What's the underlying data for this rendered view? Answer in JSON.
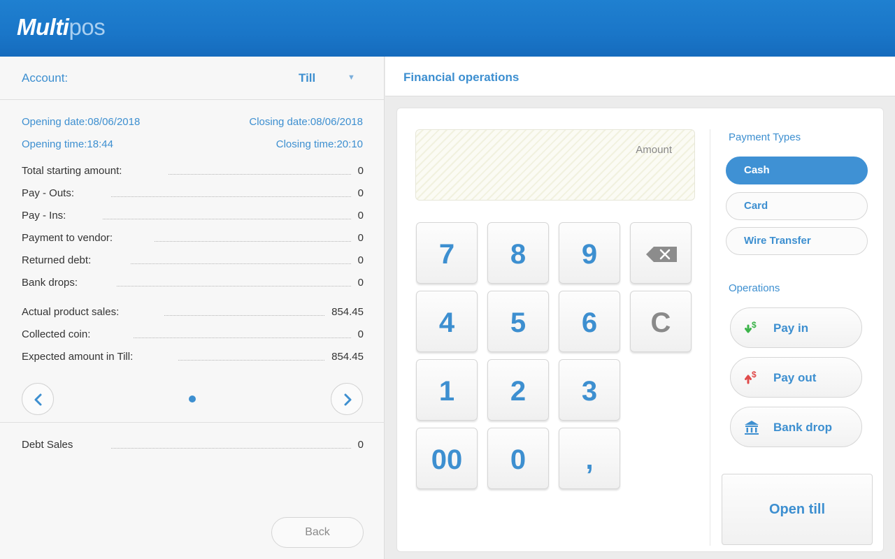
{
  "header": {
    "logo_bold": "Multi",
    "logo_light": "pos"
  },
  "left": {
    "account_label": "Account:",
    "account_value": "Till",
    "opening_date": "Opening date:08/06/2018",
    "closing_date": "Closing date:08/06/2018",
    "opening_time": "Opening time:18:44",
    "closing_time": "Closing time:20:10",
    "rows": [
      {
        "label": "Total starting amount:",
        "value": "0"
      },
      {
        "label": "Pay - Outs:",
        "value": "0"
      },
      {
        "label": "Pay - Ins:",
        "value": "0"
      },
      {
        "label": "Payment to vendor:",
        "value": "0"
      },
      {
        "label": "Returned debt:",
        "value": "0"
      },
      {
        "label": "Bank drops:",
        "value": "0"
      },
      {
        "label": "Actual product sales:",
        "value": "854.45"
      },
      {
        "label": "Collected coin:",
        "value": "0"
      },
      {
        "label": "Expected amount in Till:",
        "value": "854.45"
      }
    ],
    "debt_sales": {
      "label": "Debt Sales",
      "value": "0"
    },
    "back_label": "Back"
  },
  "right": {
    "title": "Financial operations",
    "amount_placeholder": "Amount",
    "keys": [
      "7",
      "8",
      "9",
      "4",
      "5",
      "6",
      "C",
      "1",
      "2",
      "3",
      "00",
      "0",
      ","
    ],
    "payment_types_title": "Payment Types",
    "payment_types": [
      "Cash",
      "Card",
      "Wire Transfer"
    ],
    "selected_payment_type": "Cash",
    "operations_title": "Operations",
    "operations": [
      "Pay in",
      "Pay out",
      "Bank drop"
    ],
    "open_till_label": "Open till"
  },
  "colors": {
    "brand": "#1a76c8",
    "accent": "#3d8fd0",
    "pay_in_icon": "#3cb44a",
    "pay_out_icon": "#e04b4b"
  },
  "icons": {
    "backspace": "backspace-icon",
    "prev": "chevron-left-icon",
    "next": "chevron-right-icon",
    "pay_in": "money-in-icon",
    "pay_out": "money-out-icon",
    "bank_drop": "bank-icon"
  }
}
